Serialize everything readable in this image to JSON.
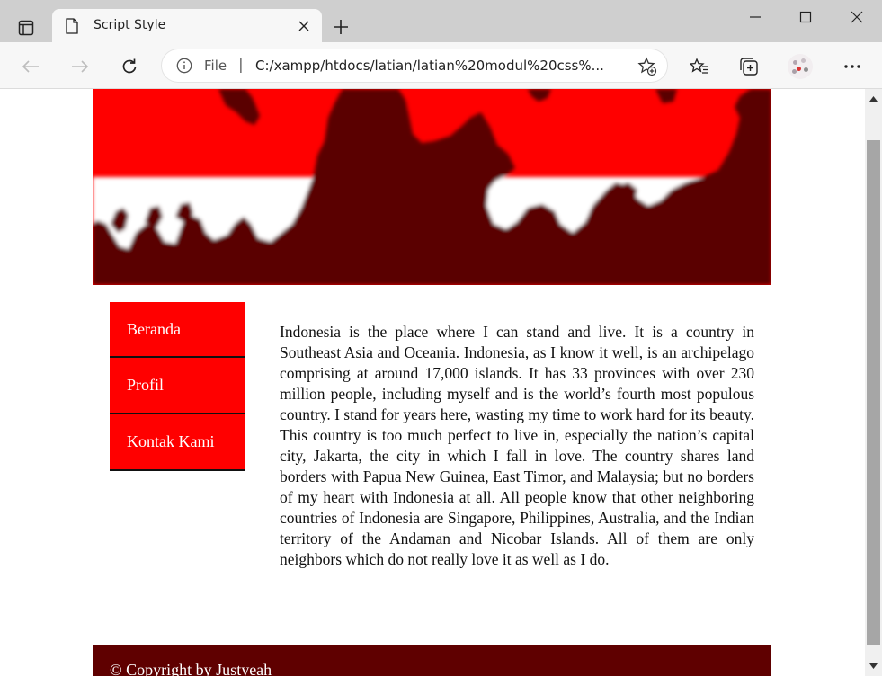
{
  "browser": {
    "tab_title": "Script Style",
    "omnibox": {
      "scheme_label": "File",
      "separator": "|",
      "url": "C:/xampp/htdocs/latian/latian%20modul%20css%..."
    },
    "icons": [
      "tab-actions-icon",
      "page-icon",
      "close-icon",
      "plus-icon",
      "minimize-icon",
      "maximize-icon",
      "window-close-icon",
      "back-arrow-icon",
      "forward-arrow-icon",
      "refresh-icon",
      "info-icon",
      "add-favorite-icon",
      "favorites-icon",
      "collections-icon",
      "profile-avatar",
      "more-icon"
    ]
  },
  "page": {
    "banner": {
      "colors": {
        "red": "#ff0000",
        "dark": "#5a0000",
        "white": "#ffffff"
      }
    },
    "menu": {
      "items": [
        {
          "label": "Beranda"
        },
        {
          "label": "Profil"
        },
        {
          "label": "Kontak Kami"
        }
      ],
      "color": "#ff0000"
    },
    "article": {
      "text": "Indonesia is the place where I can stand and live. It is a country in Southeast Asia and Oceania. Indonesia, as I know it well, is an archipelago comprising at around 17,000 islands. It has 33 provinces with over 230 million people, including myself and is the world’s fourth most populous country. I stand for years here, wasting my time to work hard for its beauty. This country is too much perfect to live in, especially the nation’s capital city, Jakarta, the city in which I fall in love. The country shares land borders with Papua New Guinea, East Timor, and Malaysia; but no borders of my heart with Indonesia at all. All people know that other neighboring countries of Indonesia are Singapore, Philippines, Australia, and the Indian territory of the Andaman and Nicobar Islands. All of them are only neighbors which do not really love it as well as I do."
    },
    "footer": {
      "text": "© Copyright by Justyeah",
      "color": "#5f0000"
    }
  }
}
